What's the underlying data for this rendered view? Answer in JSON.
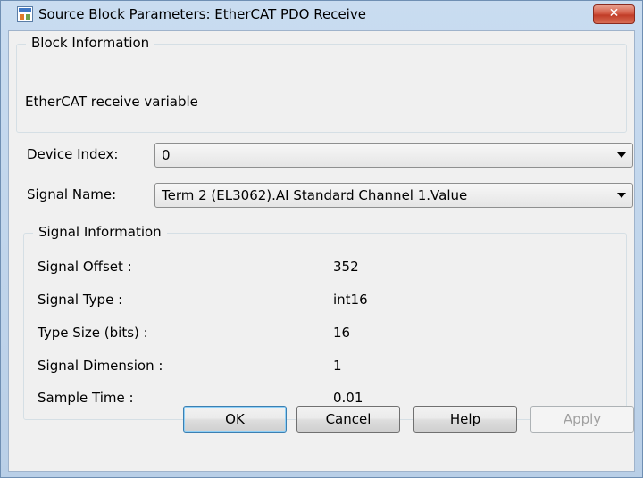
{
  "window": {
    "title": "Source Block Parameters: EtherCAT PDO Receive",
    "close_label": "✕"
  },
  "block_info": {
    "legend": "Block Information",
    "description": "EtherCAT receive variable"
  },
  "device_index": {
    "label": "Device Index:",
    "value": "0"
  },
  "signal_name": {
    "label": "Signal Name:",
    "value": "Term 2 (EL3062).AI Standard Channel 1.Value"
  },
  "signal_info": {
    "legend": "Signal Information",
    "rows": [
      {
        "label": "Signal Offset :",
        "value": "352"
      },
      {
        "label": "Signal Type :",
        "value": "int16"
      },
      {
        "label": "Type Size (bits) :",
        "value": "16"
      },
      {
        "label": "Signal Dimension :",
        "value": "1"
      },
      {
        "label": "Sample Time :",
        "value": "0.01"
      }
    ]
  },
  "buttons": {
    "ok": "OK",
    "cancel": "Cancel",
    "help": "Help",
    "apply": "Apply"
  },
  "colors": {
    "titlebar": "#c9dcf0",
    "close": "#c94a36",
    "client": "#f0f0f0",
    "default_button_border": "#3c7fb1"
  },
  "icons": {
    "app": "simulink-block-icon",
    "close": "close-icon",
    "dropdown": "chevron-down-icon"
  }
}
